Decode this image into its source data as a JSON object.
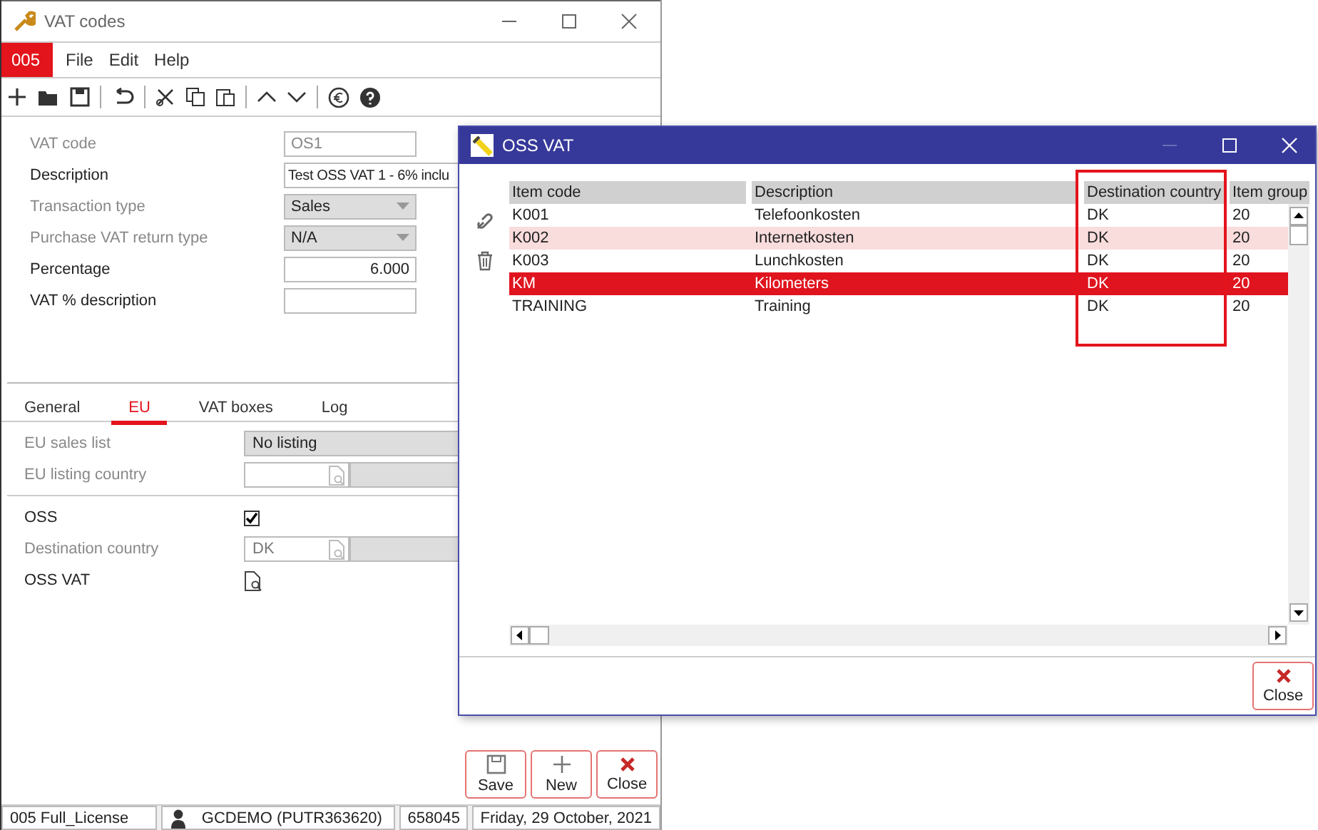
{
  "main_window": {
    "title": "VAT codes",
    "company": "005",
    "menus": [
      "File",
      "Edit",
      "Help"
    ],
    "fields": [
      {
        "label": "VAT code",
        "value": "OS1",
        "kind": "text",
        "enabled": false
      },
      {
        "label": "Description",
        "value": "Test OSS VAT 1 - 6% inclu",
        "kind": "wide",
        "enabled": true
      },
      {
        "label": "Transaction type",
        "value": "Sales",
        "kind": "select",
        "enabled": false
      },
      {
        "label": "Purchase VAT return type",
        "value": "N/A",
        "kind": "select",
        "enabled": false
      },
      {
        "label": "Percentage",
        "value": "6.000",
        "kind": "number",
        "enabled": true
      },
      {
        "label": "VAT % description",
        "kind": "text",
        "enabled": true
      }
    ],
    "tabs": [
      {
        "label": "General",
        "selected": false
      },
      {
        "label": "EU",
        "selected": true
      },
      {
        "label": "VAT boxes",
        "selected": false
      },
      {
        "label": "Log",
        "selected": false
      }
    ],
    "eu_fields": [
      {
        "label": "EU sales list",
        "value": "No listing",
        "kind": "select",
        "enabled": false
      },
      {
        "label": "EU listing country",
        "kind": "lookup",
        "enabled": false
      },
      {
        "label": "OSS",
        "kind": "checkbox",
        "checked": true,
        "enabled": true
      },
      {
        "label": "Destination country",
        "value": "DK",
        "kind": "lookup",
        "enabled": false
      },
      {
        "label": "OSS VAT",
        "kind": "lookup_button",
        "enabled": true
      }
    ],
    "buttons": [
      {
        "label": "Save",
        "kind": "save"
      },
      {
        "label": "New",
        "kind": "new"
      },
      {
        "label": "Close",
        "kind": "close"
      }
    ],
    "status_bar": [
      {
        "text": "005 Full_License",
        "kind": "text"
      },
      {
        "text": "GCDEMO (PUTR363620)",
        "kind": "user"
      },
      {
        "text": "658045",
        "kind": "text"
      },
      {
        "text": "Friday, 29 October, 2021",
        "kind": "text"
      }
    ]
  },
  "dialog": {
    "title": "OSS VAT",
    "columns": [
      "Item code",
      "Description",
      "Destination country",
      "Item group"
    ],
    "rows": [
      {
        "cells": [
          "K001",
          "Telefoonkosten",
          "DK",
          "20"
        ],
        "selected": false,
        "highlighted": false
      },
      {
        "cells": [
          "K002",
          "Internetkosten",
          "DK",
          "20"
        ],
        "selected": false,
        "highlighted": true
      },
      {
        "cells": [
          "K003",
          "Lunchkosten",
          "DK",
          "20"
        ],
        "selected": false,
        "highlighted": false
      },
      {
        "cells": [
          "KM",
          "Kilometers",
          "DK",
          "20"
        ],
        "selected": true,
        "highlighted": false
      },
      {
        "cells": [
          "TRAINING",
          "Training",
          "DK",
          "20"
        ],
        "selected": false,
        "highlighted": false
      }
    ],
    "close_button": "Close"
  }
}
